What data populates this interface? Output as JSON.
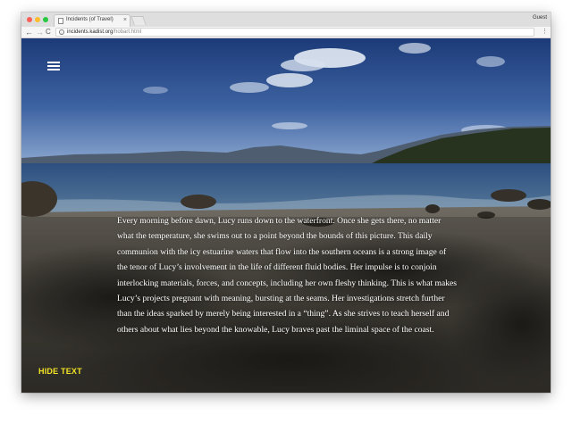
{
  "browser": {
    "tab_title": "Incidents (of Travel)",
    "tab_close": "×",
    "profile_name": "Guest",
    "url_domain": "incidents.kadist.org",
    "url_path": "/hobart.html",
    "back_glyph": "←",
    "forward_glyph": "→",
    "reload_glyph": "C",
    "info_glyph": "i",
    "menu_glyph": "⋮"
  },
  "page": {
    "story_text": "Every morning before dawn, Lucy runs down to the waterfront. Once she gets there, no matter what the temperature, she swims out to a point beyond the bounds of this picture. This daily communion with the icy estuarine waters that flow into the southern oceans is a strong image of the tenor of Lucy’s involvement in the life of different fluid bodies. Her impulse is to conjoin interlocking materials, forces, and concepts, including her own fleshy thinking. This is what makes Lucy’s projects pregnant with meaning, bursting at the seams. Her investigations stretch further than the ideas sparked by merely being interested in a “thing”. As she strives to teach herself and others about what lies beyond the knowable, Lucy braves past the liminal space of the coast.",
    "hide_text_label": "HIDE TEXT",
    "accent_color": "#f4e425"
  },
  "icons": {
    "menu": "hamburger-menu-icon",
    "site_info": "info-icon"
  }
}
